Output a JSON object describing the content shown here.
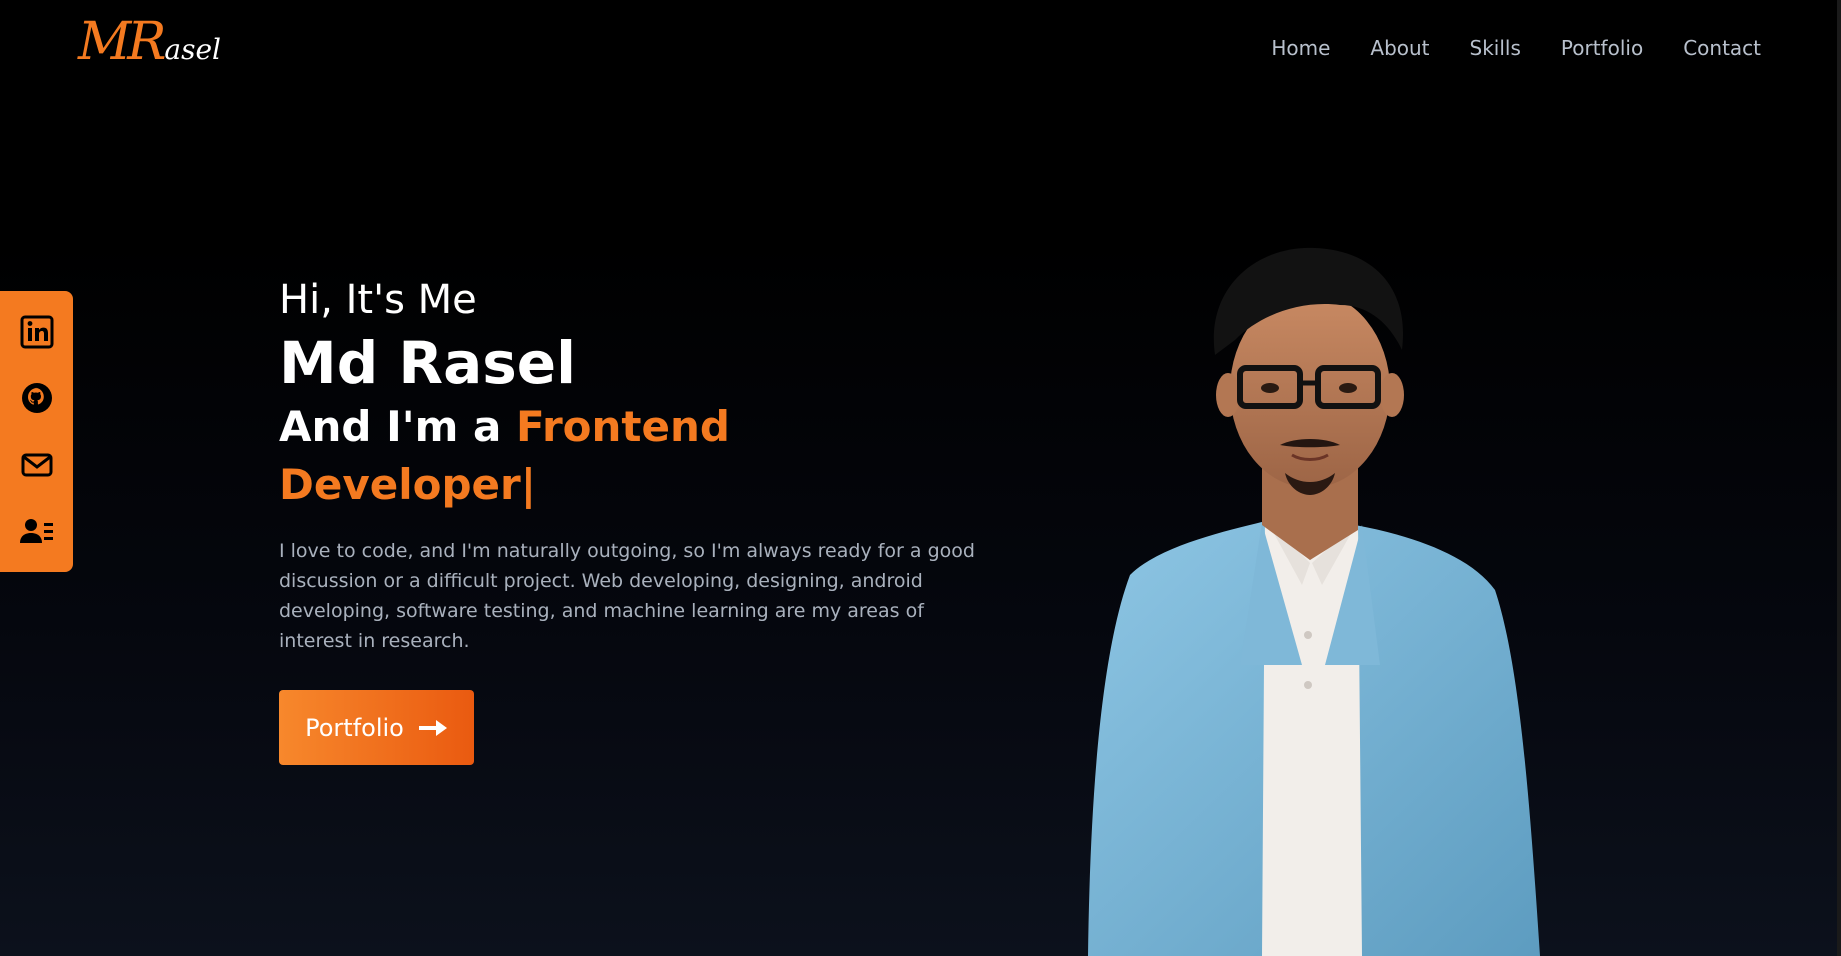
{
  "header": {
    "logo_initials": "MR",
    "logo_rest": "asel",
    "nav": [
      {
        "label": "Home"
      },
      {
        "label": "About"
      },
      {
        "label": "Skills"
      },
      {
        "label": "Portfolio"
      },
      {
        "label": "Contact"
      }
    ]
  },
  "social": [
    {
      "icon": "linkedin-icon"
    },
    {
      "icon": "github-icon"
    },
    {
      "icon": "mail-icon"
    },
    {
      "icon": "contact-card-icon"
    }
  ],
  "hero": {
    "greeting": "Hi, It's Me",
    "name": "Md Rasel",
    "role_prefix": "And I'm a ",
    "role_highlight": "Frontend Developer|",
    "description": "I love to code, and I'm naturally outgoing, so I'm always ready for a good discussion or a difficult project. Web developing, designing, android developing, software testing, and machine learning are my areas of interest in research.",
    "cta_label": "Portfolio",
    "cta_icon": "arrow-right-icon"
  },
  "colors": {
    "accent": "#f47a20",
    "background": "#000000",
    "nav_text": "#b8c0cc",
    "body_text": "#a9b1bd"
  }
}
